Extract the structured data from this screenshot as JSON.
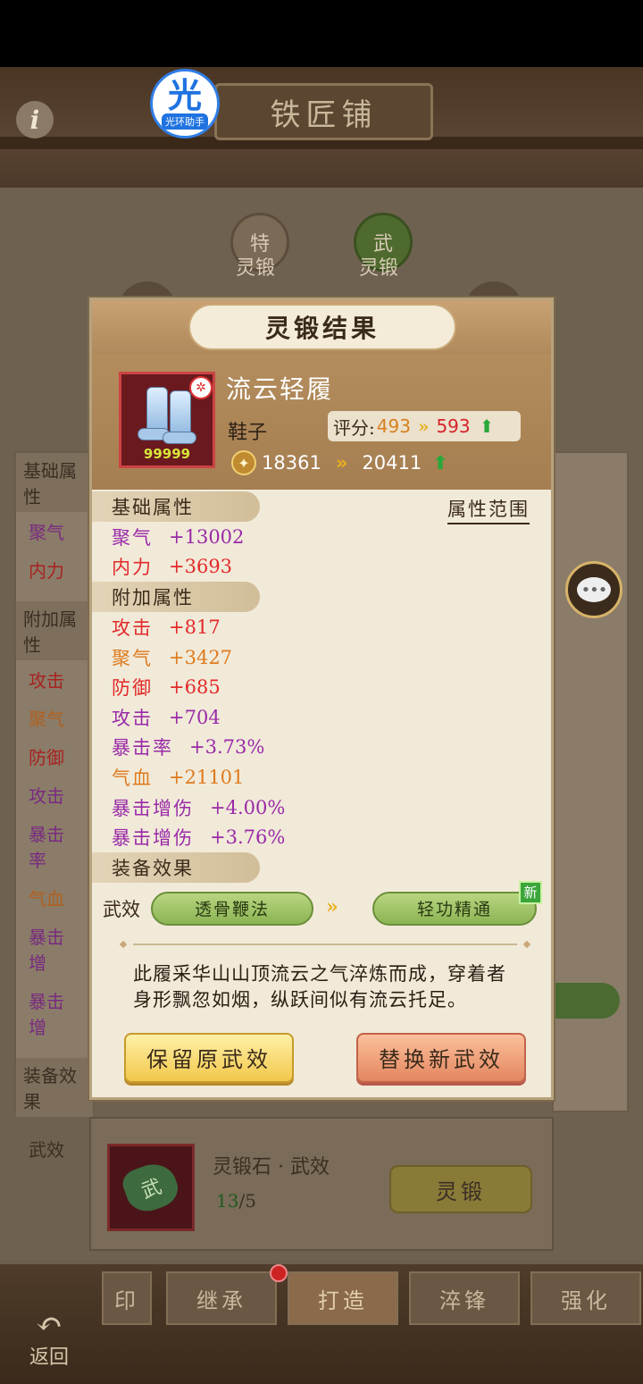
{
  "header": {
    "title": "铁匠铺",
    "info_icon": "info-icon",
    "assistant_badge": {
      "glyph": "光",
      "label": "光环助手"
    }
  },
  "forge_tabs": [
    {
      "top": "特",
      "bottom": "灵锻"
    },
    {
      "top": "武",
      "bottom": "灵锻"
    }
  ],
  "background_panel": {
    "base_header": "基础属性",
    "base_rows": [
      "聚气",
      "内力"
    ],
    "extra_header": "附加属性",
    "extra_rows": [
      "攻击",
      "聚气",
      "防御",
      "攻击",
      "暴击率",
      "气血",
      "暴击增",
      "暴击增"
    ],
    "effect_header": "装备效果",
    "effect_row": "武效"
  },
  "modal": {
    "title": "灵锻结果",
    "item": {
      "name": "流云轻履",
      "type": "鞋子",
      "level": "99999",
      "score_label": "评分:",
      "score_old": "493",
      "score_new": "593",
      "power_old": "18361",
      "power_new": "20411"
    },
    "attr_range_label": "属性范围",
    "base_header": "基础属性",
    "base_attrs": [
      {
        "name": "聚气",
        "value": "+13002",
        "color": "purple"
      },
      {
        "name": "内力",
        "value": "+3693",
        "color": "red"
      }
    ],
    "extra_header": "附加属性",
    "extra_attrs": [
      {
        "name": "攻击",
        "value": "+817",
        "color": "red"
      },
      {
        "name": "聚气",
        "value": "+3427",
        "color": "orange"
      },
      {
        "name": "防御",
        "value": "+685",
        "color": "red"
      },
      {
        "name": "攻击",
        "value": "+704",
        "color": "purple"
      },
      {
        "name": "暴击率",
        "value": "+3.73%",
        "color": "purple"
      },
      {
        "name": "气血",
        "value": "+21101",
        "color": "orange"
      },
      {
        "name": "暴击增伤",
        "value": "+4.00%",
        "color": "purple"
      },
      {
        "name": "暴击增伤",
        "value": "+3.76%",
        "color": "purple"
      }
    ],
    "effect_header": "装备效果",
    "effect_label": "武效",
    "effect_old": "透骨鞭法",
    "effect_new": "轻功精通",
    "new_tag": "新",
    "description": "此履采华山山顶流云之气淬炼而成，穿着者身形飘忽如烟，纵跃间似有流云托足。",
    "keep_button": "保留原武效",
    "replace_button": "替换新武效"
  },
  "material": {
    "name": "灵锻石 · 武效",
    "have": "13",
    "need": "/5",
    "stone_glyph": "武",
    "forge_button": "灵锻"
  },
  "bottom_nav": {
    "tabs": [
      "印",
      "继承",
      "打造",
      "淬锋",
      "强化"
    ],
    "active": "打造",
    "back_label": "返回"
  },
  "colors": {
    "purple": "#9a2aa8",
    "red": "#e22a2a",
    "orange": "#de7a1e",
    "accent_gold": "#e8b020",
    "up_green": "#2aa83a"
  }
}
